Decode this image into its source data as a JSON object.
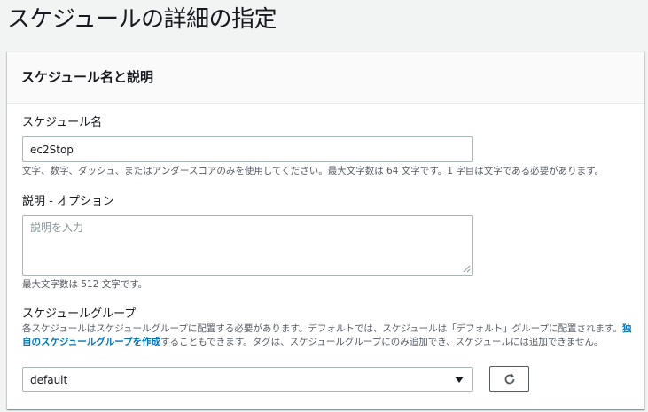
{
  "page": {
    "title": "スケジュールの詳細の指定"
  },
  "panel": {
    "title": "スケジュール名と説明",
    "name_field": {
      "label": "スケジュール名",
      "value": "ec2Stop",
      "description": "文字、数字、ダッシュ、またはアンダースコアのみを使用してください。最大文字数は 64 文字です。1 字目は文字である必要があります。"
    },
    "description_field": {
      "label": "説明 - オプション",
      "placeholder": "説明を入力",
      "hint": "最大文字数は 512 文字です。"
    },
    "group_field": {
      "label": "スケジュールグループ",
      "desc_part1": "各スケジュールはスケジュールグループに配置する必要があります。デフォルトでは、スケジュールは「デフォルト」グループに配置されます。",
      "link_text": "独自のスケジュールグループを作成",
      "desc_part2": "することもできます。タグは、スケジュールグループにのみ追加でき、スケジュールには追加できません。",
      "selected": "default",
      "refresh_icon": "refresh-icon"
    }
  }
}
